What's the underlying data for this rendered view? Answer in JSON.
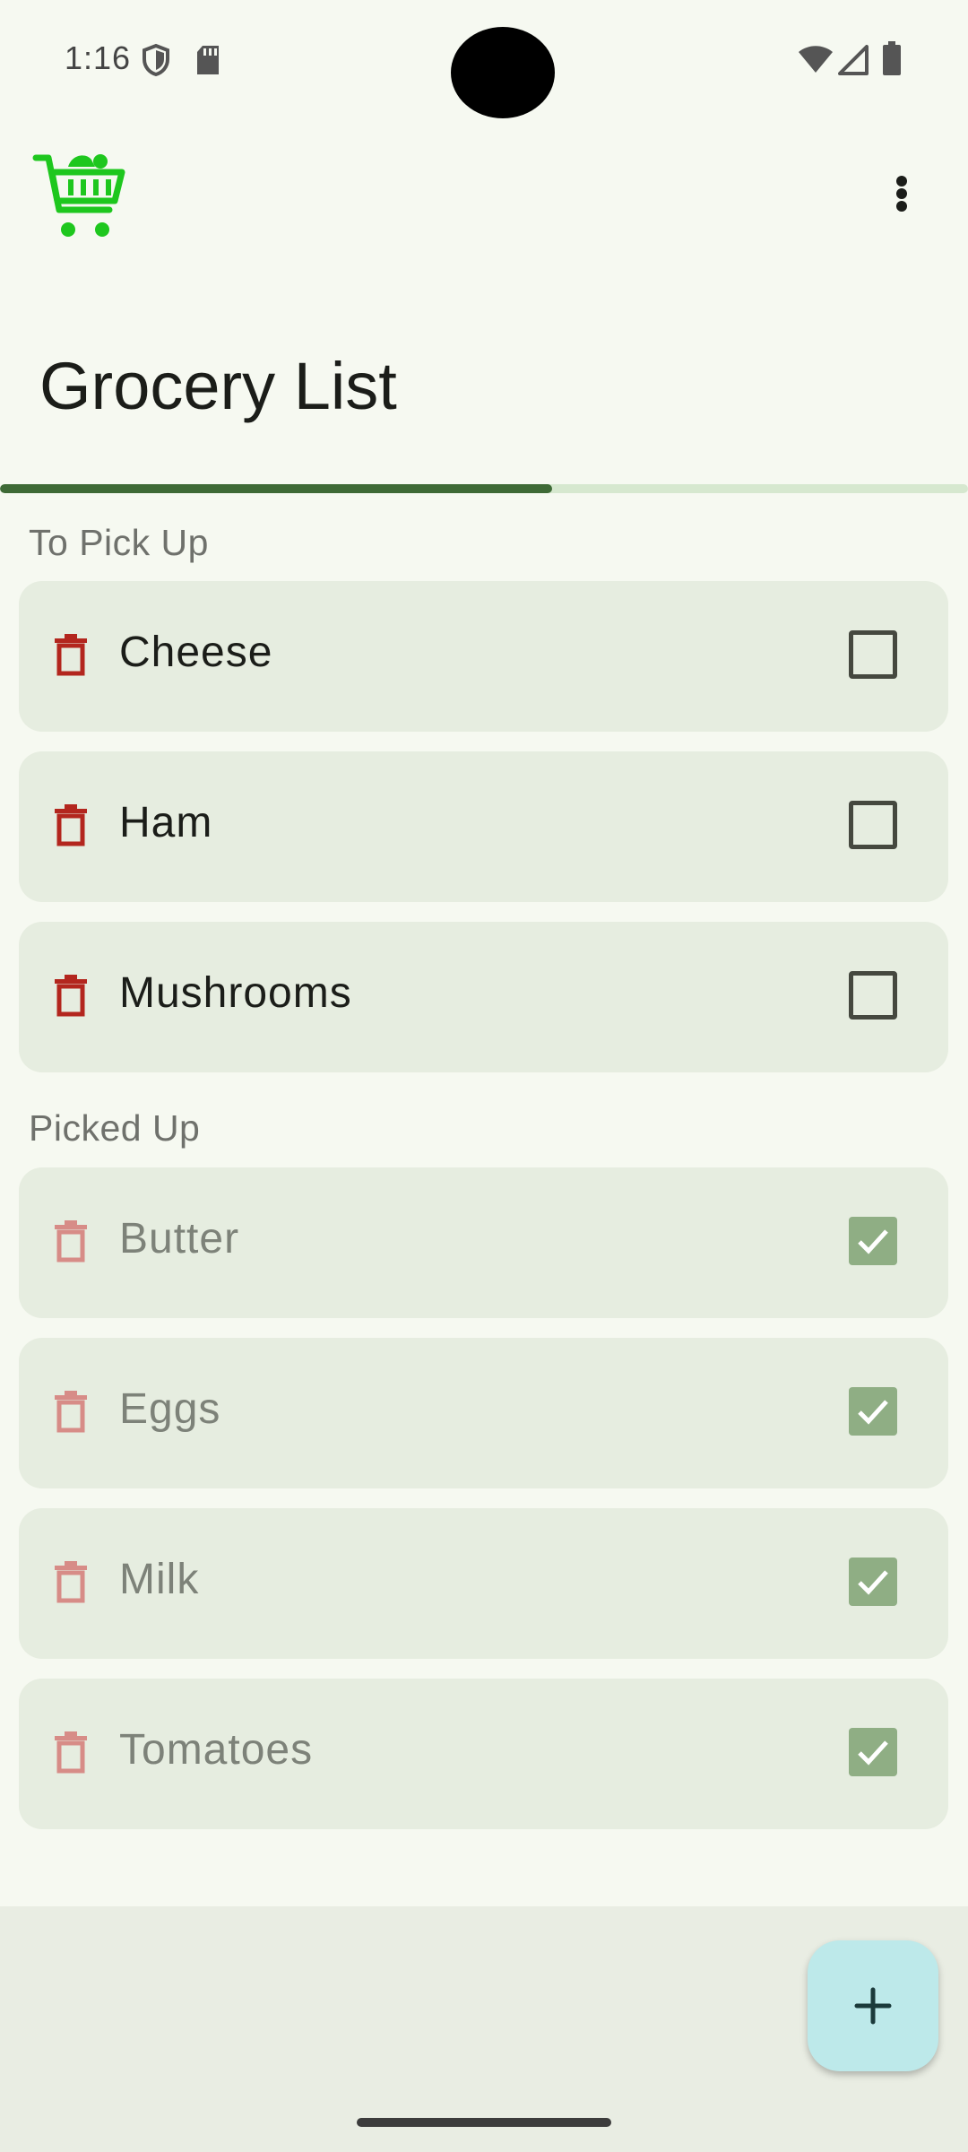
{
  "status_bar": {
    "time": "1:16",
    "icons": [
      "shield-icon",
      "sd-card-icon",
      "wifi-icon",
      "signal-icon",
      "battery-icon"
    ]
  },
  "app": {
    "logo_icon": "shopping-cart-icon",
    "logo_color": "#1ec71e",
    "menu_icon": "more-vert-icon",
    "title": "Grocery List"
  },
  "progress": {
    "fraction_picked": 0.57
  },
  "sections": {
    "to_pick_up": {
      "header": "To Pick Up",
      "items": [
        {
          "label": "Cheese",
          "checked": false
        },
        {
          "label": "Ham",
          "checked": false
        },
        {
          "label": "Mushrooms",
          "checked": false
        }
      ]
    },
    "picked_up": {
      "header": "Picked Up",
      "items": [
        {
          "label": "Butter",
          "checked": true
        },
        {
          "label": "Eggs",
          "checked": true
        },
        {
          "label": "Milk",
          "checked": true
        },
        {
          "label": "Tomatoes",
          "checked": true
        }
      ]
    }
  },
  "colors": {
    "delete_active": "#b3261e",
    "delete_faded": "#d78c87",
    "check_fill": "#8fae84",
    "progress_fill": "#3e6a36",
    "fab_bg": "#bde9ea"
  },
  "fab": {
    "icon": "plus-icon"
  }
}
